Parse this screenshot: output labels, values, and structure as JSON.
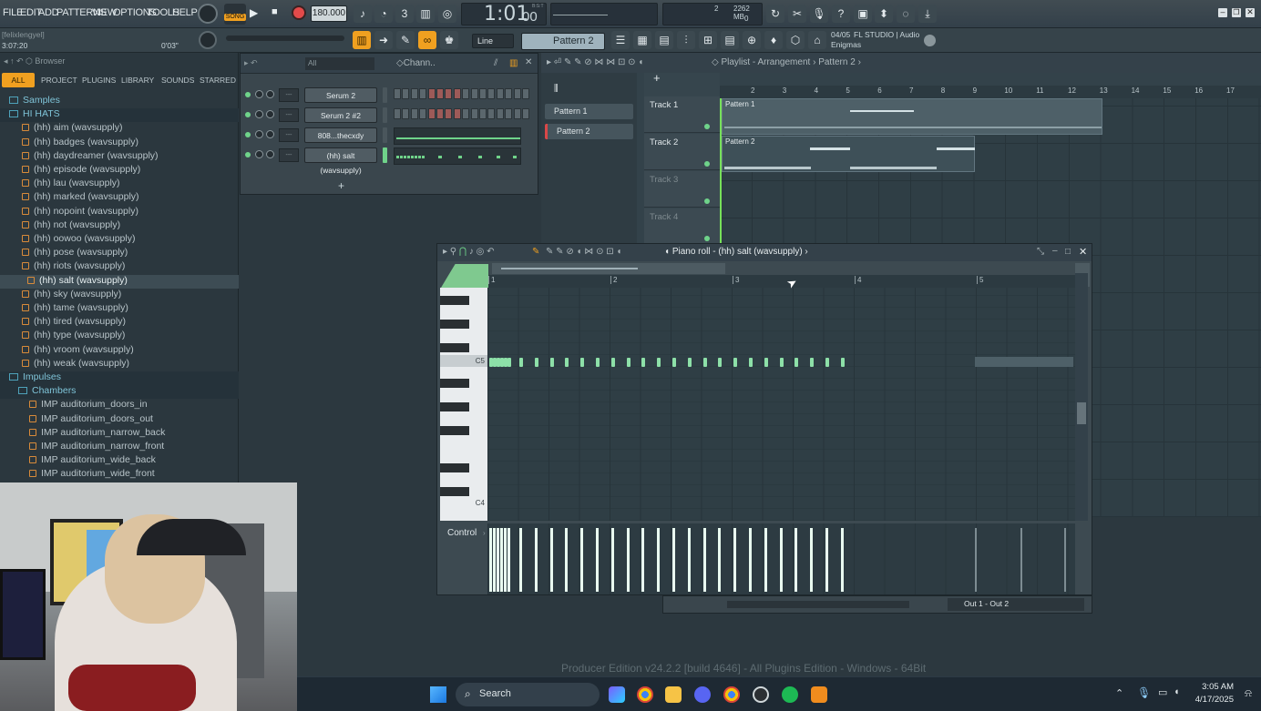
{
  "menubar": {
    "items": [
      "FILE",
      "EDIT",
      "ADD",
      "PATTERNS",
      "VIEW",
      "OPTIONS",
      "TOOLS",
      "HELP"
    ],
    "song_mode": "SONG",
    "tempo": "180.000",
    "time_main": "1:01",
    "time_sub": "00",
    "time_label": "B:S:T",
    "cpu_value": "2",
    "memory": "2262 MB",
    "poly": "0"
  },
  "hint": {
    "user": "[felixlengyel]",
    "elapsed": "3:07:20",
    "time2": "0'03\""
  },
  "toolbar": {
    "snap": "Line",
    "pattern": "Pattern 2",
    "news_date": "04/05",
    "news_title": "FL STUDIO | Audio",
    "news_sub": "Enigmas"
  },
  "browser": {
    "header": "Browser",
    "tabs": [
      "ALL",
      "PROJECT",
      "PLUGINS",
      "LIBRARY",
      "SOUNDS",
      "STARRED"
    ],
    "items": [
      {
        "t": "Samples",
        "kind": "folder"
      },
      {
        "t": "HI HATS",
        "kind": "folder-open"
      },
      {
        "t": "(hh) aim (wavsupply)",
        "kind": "file"
      },
      {
        "t": "(hh) badges (wavsupply)",
        "kind": "file"
      },
      {
        "t": "(hh) daydreamer (wavsupply)",
        "kind": "file"
      },
      {
        "t": "(hh) episode (wavsupply)",
        "kind": "file"
      },
      {
        "t": "(hh) lau (wavsupply)",
        "kind": "file"
      },
      {
        "t": "(hh) marked (wavsupply)",
        "kind": "file"
      },
      {
        "t": "(hh) nopoint (wavsupply)",
        "kind": "file"
      },
      {
        "t": "(hh) not (wavsupply)",
        "kind": "file"
      },
      {
        "t": "(hh) oowoo (wavsupply)",
        "kind": "file"
      },
      {
        "t": "(hh) pose (wavsupply)",
        "kind": "file"
      },
      {
        "t": "(hh) riots (wavsupply)",
        "kind": "file"
      },
      {
        "t": "(hh) salt (wavsupply)",
        "kind": "file-selected"
      },
      {
        "t": "(hh) sky (wavsupply)",
        "kind": "file"
      },
      {
        "t": "(hh) tame (wavsupply)",
        "kind": "file"
      },
      {
        "t": "(hh) tired (wavsupply)",
        "kind": "file"
      },
      {
        "t": "(hh) type (wavsupply)",
        "kind": "file"
      },
      {
        "t": "(hh) vroom (wavsupply)",
        "kind": "file"
      },
      {
        "t": "(hh) weak (wavsupply)",
        "kind": "file"
      },
      {
        "t": "Impulses",
        "kind": "folder-open"
      },
      {
        "t": "Chambers",
        "kind": "folder-open"
      },
      {
        "t": "IMP auditorium_doors_in",
        "kind": "file"
      },
      {
        "t": "IMP auditorium_doors_out",
        "kind": "file"
      },
      {
        "t": "IMP auditorium_narrow_back",
        "kind": "file"
      },
      {
        "t": "IMP auditorium_narrow_front",
        "kind": "file"
      },
      {
        "t": "IMP auditorium_wide_back",
        "kind": "file"
      },
      {
        "t": "IMP auditorium_wide_front",
        "kind": "file"
      }
    ]
  },
  "channel_rack": {
    "title": "Chann..",
    "filter": "All",
    "channels": [
      {
        "name": "Serum 2"
      },
      {
        "name": "Serum 2 #2"
      },
      {
        "name": "808...thecxdy"
      },
      {
        "name": "(hh) salt (wavsupply)"
      }
    ],
    "add": "+"
  },
  "playlist": {
    "title": "Playlist - Arrangement",
    "sep": "›",
    "pattern": "Pattern 2",
    "patterns": [
      "Pattern 1",
      "Pattern 2"
    ],
    "tracks": [
      "Track 1",
      "Track 2",
      "Track 3",
      "Track 4"
    ],
    "ruler": [
      "2",
      "3",
      "4",
      "5",
      "6",
      "7",
      "8",
      "9",
      "10",
      "11",
      "12",
      "13",
      "14",
      "15",
      "16",
      "17"
    ],
    "clip_track1": "Pattern 1",
    "clip_track2": "Pattern 2"
  },
  "piano_roll": {
    "title": "Piano roll - (hh) salt (wavsupply)",
    "ruler": [
      "1",
      "2",
      "3",
      "4",
      "5"
    ],
    "key_c5": "C5",
    "key_c4": "C4",
    "control": "Control",
    "out": "Out 1 - Out 2"
  },
  "status": {
    "edition": "Producer Edition v24.2.2 [build 4646] - All Plugins Edition - Windows - 64Bit"
  },
  "taskbar": {
    "search": "Search",
    "time": "3:05 AM",
    "date": "4/17/2025"
  }
}
